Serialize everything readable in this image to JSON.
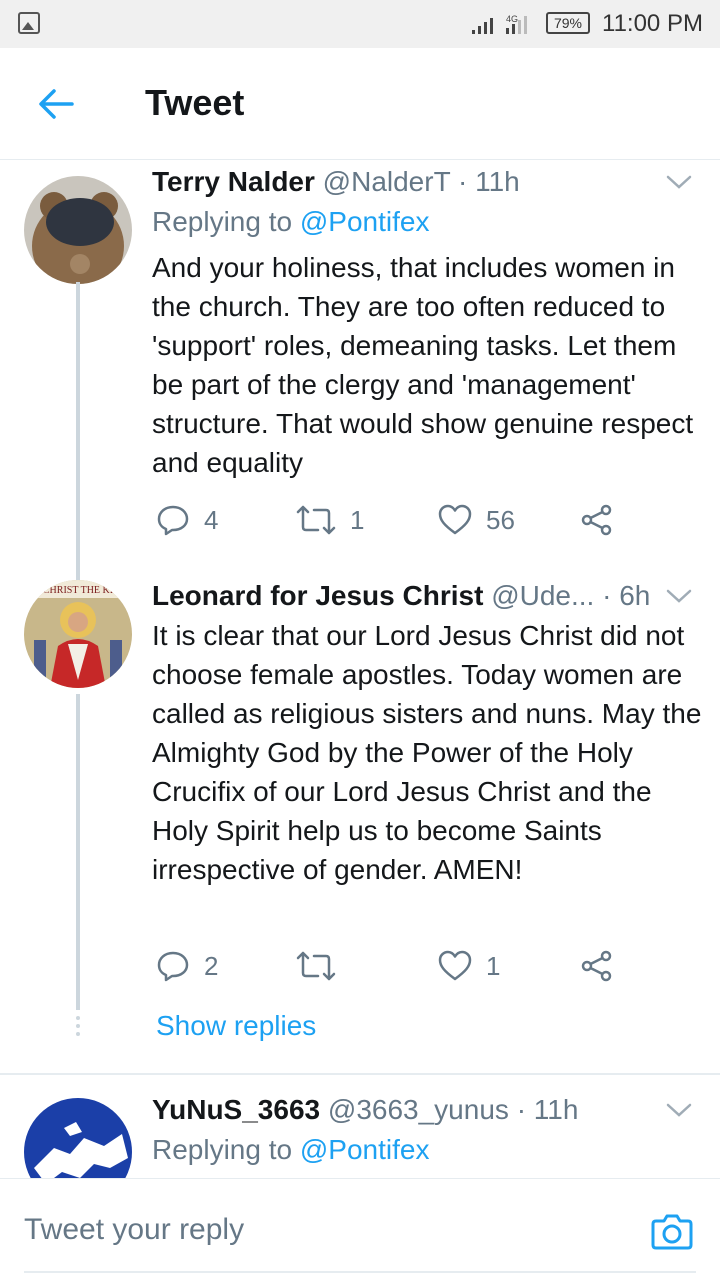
{
  "status_bar": {
    "network": "4G",
    "battery": "79%",
    "time": "11:00 PM"
  },
  "header": {
    "title": "Tweet"
  },
  "tweets": [
    {
      "name": "Terry Nalder",
      "handle": "@NalderT",
      "time": "· 11h",
      "replying_prefix": "Replying to ",
      "replying_to": "@Pontifex",
      "text": "And your holiness, that includes women in the church. They are too often reduced to 'support' roles, demeaning tasks. Let them be part of the clergy and 'management' structure. That would show genuine respect and equality",
      "replies": "4",
      "retweets": "1",
      "likes": "56"
    },
    {
      "name": "Leonard for Jesus Christ",
      "handle": "@Ude...",
      "time": "· 6h",
      "text": "It is clear that our Lord Jesus Christ did not choose female apostles. Today women are called as religious sisters and nuns. May the Almighty God by the Power of the Holy Crucifix of our Lord Jesus Christ and the Holy Spirit help us to become Saints irrespective of gender. AMEN!",
      "replies": "2",
      "retweets": "",
      "likes": "1",
      "avatar_text": "CHRIST THE KI"
    },
    {
      "name": "YuNuS_3663",
      "handle": "@3663_yunus",
      "time": "· 11h",
      "replying_prefix": "Replying to ",
      "replying_to": "@Pontifex"
    }
  ],
  "show_replies": "Show replies",
  "reply_bar": {
    "placeholder": "Tweet your reply"
  },
  "colors": {
    "accent": "#1da1f2",
    "secondary_text": "#657786",
    "thread_line": "#ccd6dd"
  }
}
